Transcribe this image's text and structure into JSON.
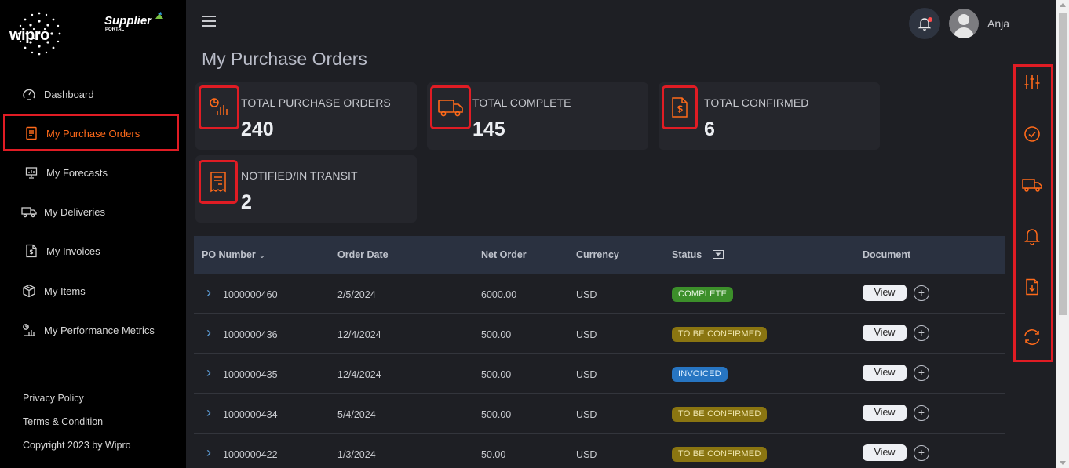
{
  "brand": {
    "wipro": "wipro",
    "supplier": "Supplier",
    "portal": "PORTAL"
  },
  "sidebar": {
    "items": [
      {
        "label": "Dashboard",
        "icon": "gauge-icon"
      },
      {
        "label": "My Purchase Orders",
        "icon": "document-icon",
        "active": true
      },
      {
        "label": "My Forecasts",
        "icon": "presentation-chart-icon"
      },
      {
        "label": "My Deliveries",
        "icon": "truck-icon"
      },
      {
        "label": "My Invoices",
        "icon": "invoice-dollar-icon"
      },
      {
        "label": "My Items",
        "icon": "box-icon"
      },
      {
        "label": "My Performance Metrics",
        "icon": "chart-metrics-icon"
      }
    ],
    "footer": {
      "privacy": "Privacy Policy",
      "terms": "Terms & Condition",
      "copyright": "Copyright 2023 by Wipro"
    }
  },
  "header": {
    "user_name": "Anjana"
  },
  "page": {
    "title": "My Purchase Orders"
  },
  "cards": [
    {
      "label": "TOTAL PURCHASE ORDERS",
      "value": "240",
      "icon": "chart-pie-bars-icon"
    },
    {
      "label": "TOTAL COMPLETE",
      "value": "145",
      "icon": "truck-icon"
    },
    {
      "label": "TOTAL CONFIRMED",
      "value": "6",
      "icon": "dollar-document-icon"
    },
    {
      "label": "NOTIFIED/IN TRANSIT",
      "value": "2",
      "icon": "receipt-icon"
    }
  ],
  "table": {
    "columns": {
      "po": "PO Number",
      "date": "Order Date",
      "net": "Net Order",
      "currency": "Currency",
      "status": "Status",
      "document": "Document"
    },
    "view_label": "View",
    "rows": [
      {
        "po": "1000000460",
        "date": "2/5/2024",
        "net": "6000.00",
        "currency": "USD",
        "status": "COMPLETE",
        "status_type": "complete"
      },
      {
        "po": "1000000436",
        "date": "12/4/2024",
        "net": "500.00",
        "currency": "USD",
        "status": "TO BE CONFIRMED",
        "status_type": "tbc"
      },
      {
        "po": "1000000435",
        "date": "12/4/2024",
        "net": "500.00",
        "currency": "USD",
        "status": "INVOICED",
        "status_type": "invoiced"
      },
      {
        "po": "1000000434",
        "date": "5/4/2024",
        "net": "500.00",
        "currency": "USD",
        "status": "TO BE CONFIRMED",
        "status_type": "tbc"
      },
      {
        "po": "1000000422",
        "date": "1/3/2024",
        "net": "50.00",
        "currency": "USD",
        "status": "TO BE CONFIRMED",
        "status_type": "tbc"
      }
    ]
  },
  "rail": {
    "icons": [
      "sliders-icon",
      "check-circle-icon",
      "truck-icon",
      "bell-icon",
      "file-download-icon",
      "refresh-icon"
    ]
  },
  "colors": {
    "accent": "#ff6a1a",
    "highlight": "#e01c24",
    "sidebar_bg": "#000000",
    "main_bg": "#1e1f24"
  }
}
